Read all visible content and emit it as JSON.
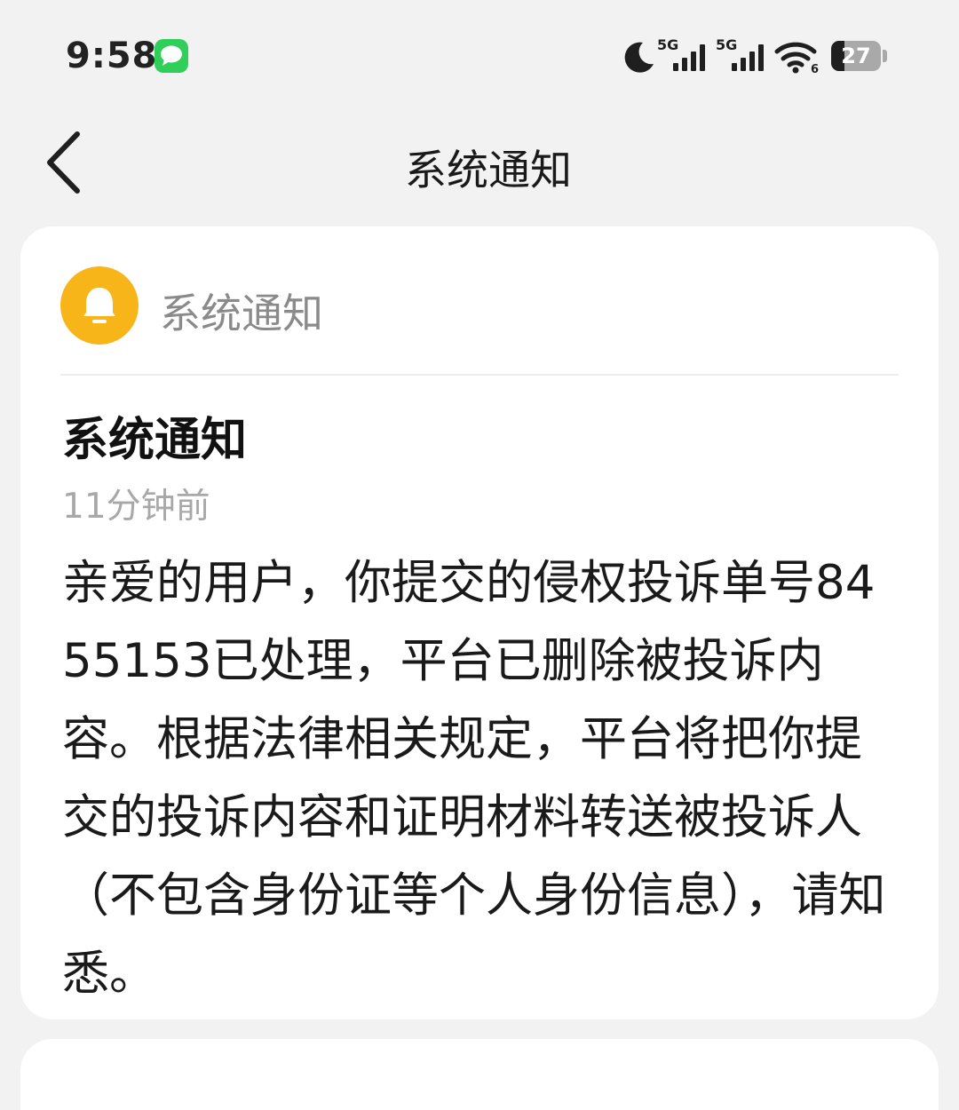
{
  "status_bar": {
    "time": "9:58",
    "notification_icon": "message-icon",
    "icons": [
      "moon-icon",
      "signal-5g-icon",
      "signal-5g-icon",
      "wifi-icon",
      "battery-icon"
    ],
    "network_label_1": "5G",
    "network_label_2": "5G",
    "wifi_badge": "6",
    "battery_level": "27",
    "battery_fraction": 0.27
  },
  "header": {
    "back_icon": "chevron-left-icon",
    "title": "系统通知"
  },
  "card": {
    "avatar_icon": "bell-icon",
    "avatar_color": "#f8b51a",
    "sender": "系统通知",
    "title": "系统通知",
    "time": "11分钟前",
    "body": "亲爱的用户，你提交的侵权投诉单号8455153已处理，平台已删除被投诉内容。根据法律相关规定，平台将把你提交的投诉内容和证明材料转送被投诉人（不包含身份证等个人身份信息），请知悉。"
  }
}
